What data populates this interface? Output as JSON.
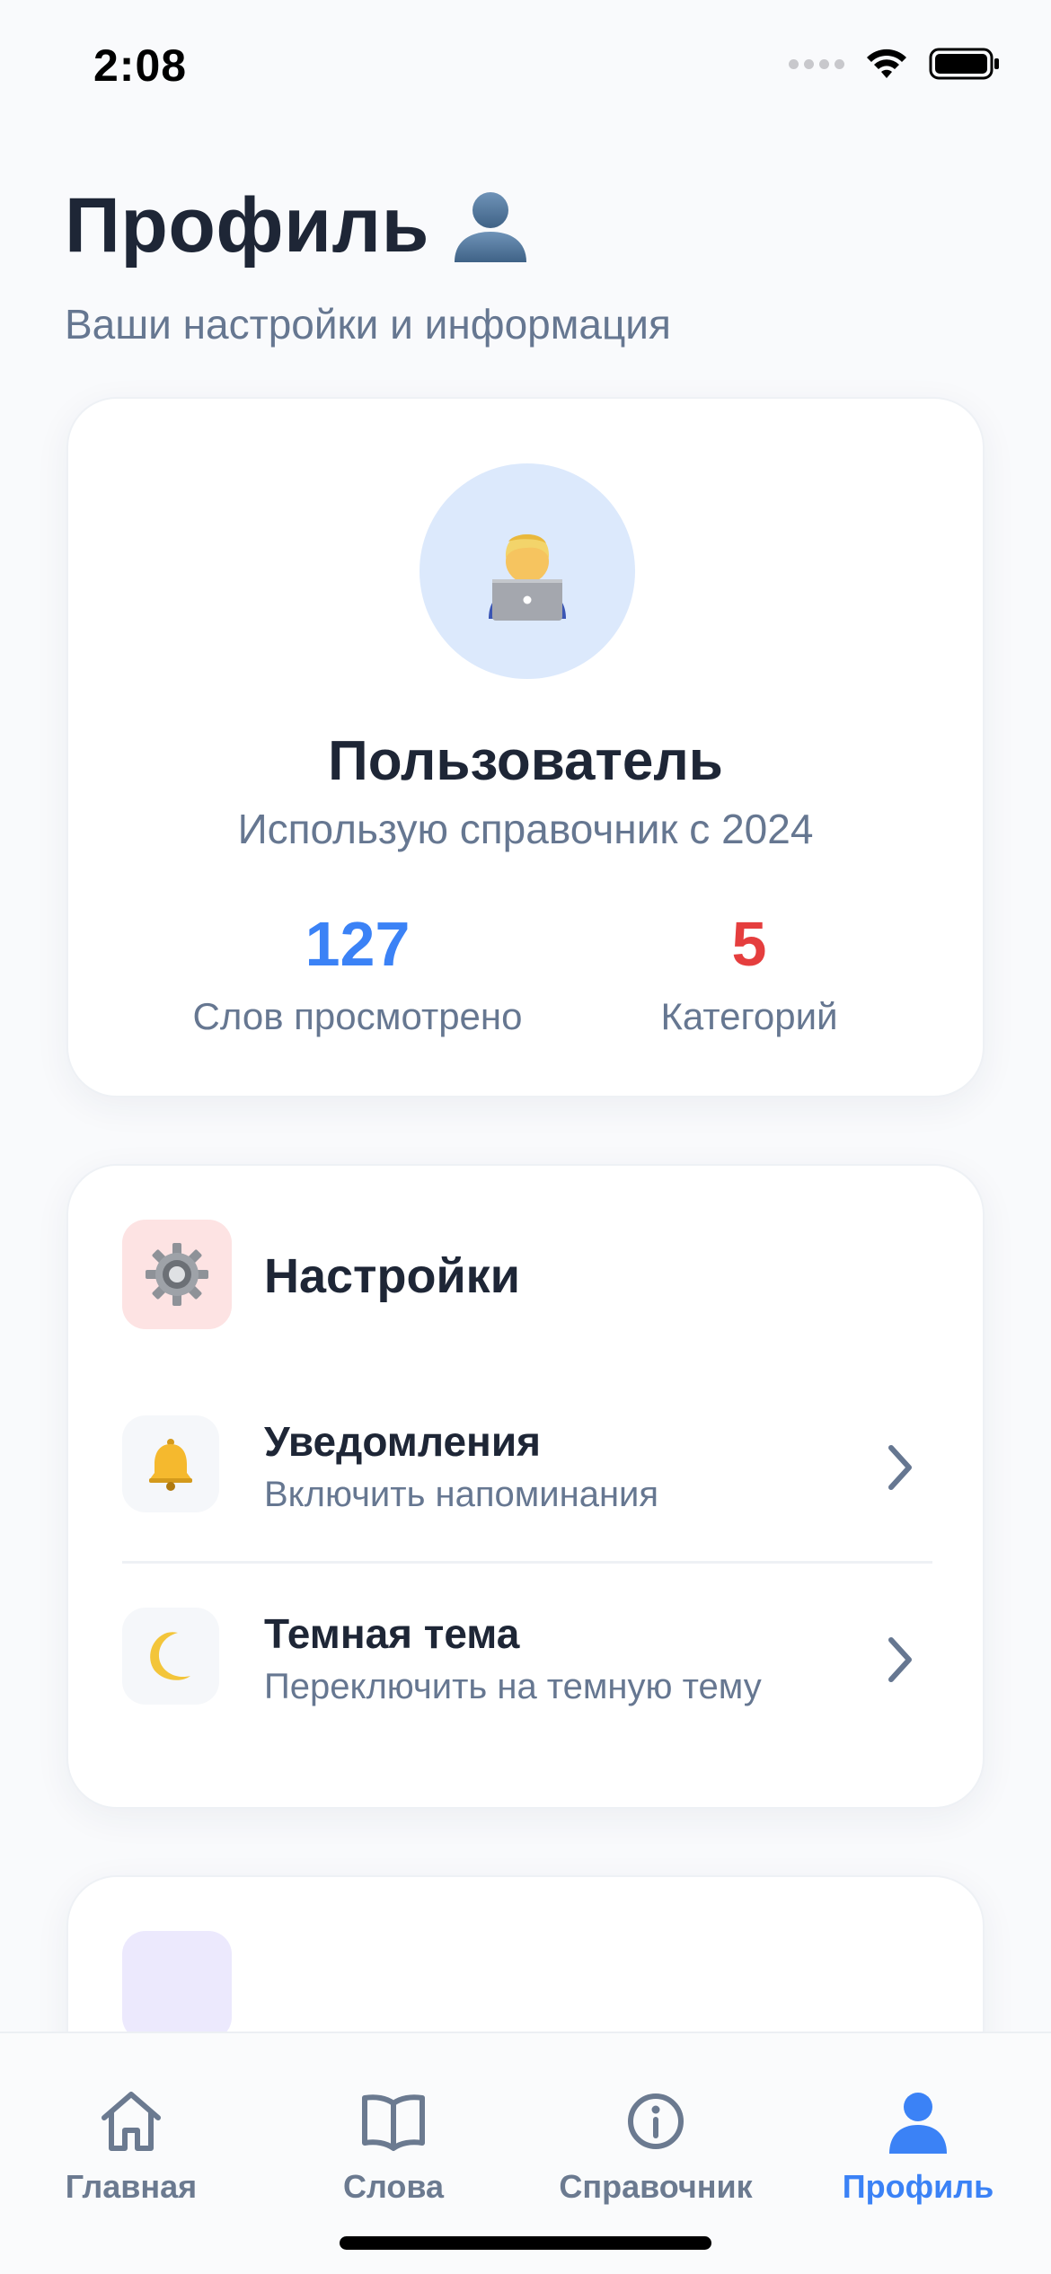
{
  "status_bar": {
    "time": "2:08"
  },
  "header": {
    "title": "Профиль",
    "title_emoji": "👤",
    "subtitle": "Ваши настройки и информация"
  },
  "profile": {
    "avatar_emoji": "👨‍💻",
    "name": "Пользователь",
    "since": "Использую справочник с 2024",
    "stats": [
      {
        "value": "127",
        "label": "Слов просмотрено",
        "color": "#3b82f6"
      },
      {
        "value": "5",
        "label": "Категорий",
        "color": "#e53e3e"
      }
    ]
  },
  "settings": {
    "title": "Настройки",
    "icon": "gear-icon",
    "items": [
      {
        "title": "Уведомления",
        "subtitle": "Включить напоминания",
        "icon": "bell-icon"
      },
      {
        "title": "Темная тема",
        "subtitle": "Переключить на темную тему",
        "icon": "moon-icon"
      }
    ]
  },
  "tabs": [
    {
      "label": "Главная",
      "icon": "home-icon",
      "active": false
    },
    {
      "label": "Слова",
      "icon": "book-icon",
      "active": false
    },
    {
      "label": "Справочник",
      "icon": "info-icon",
      "active": false
    },
    {
      "label": "Профиль",
      "icon": "person-icon",
      "active": true
    }
  ],
  "colors": {
    "accent": "#3b82f6",
    "danger": "#e53e3e",
    "text_primary": "#1e2636",
    "text_secondary": "#667791"
  }
}
